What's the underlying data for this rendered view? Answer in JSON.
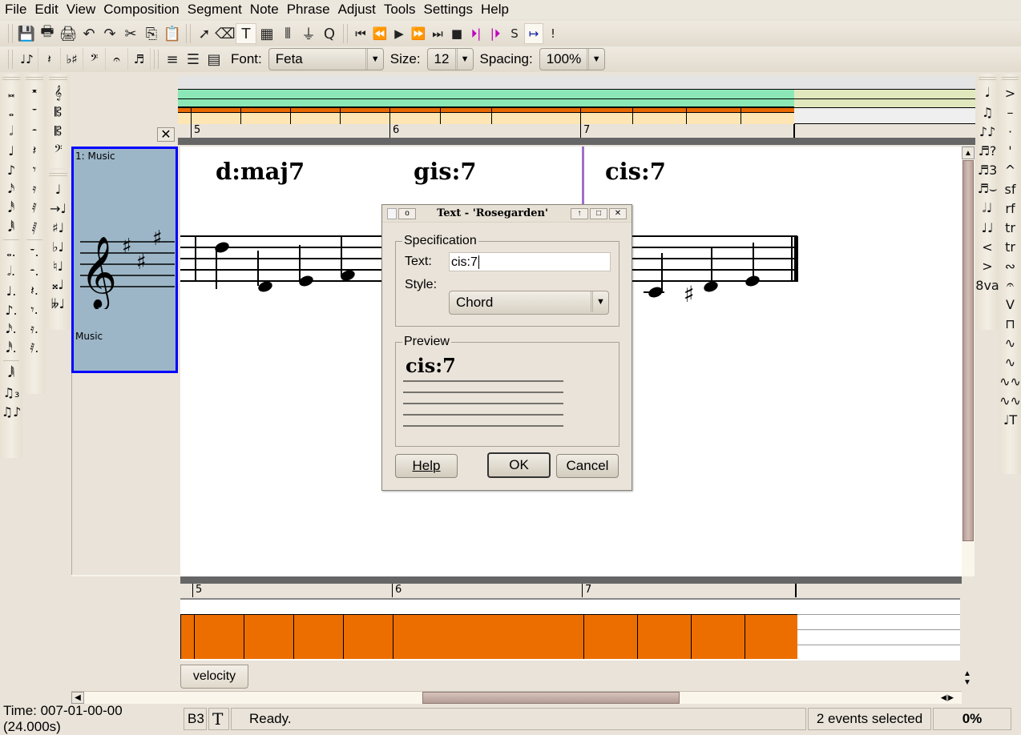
{
  "menu": [
    {
      "label": "File",
      "u": "F"
    },
    {
      "label": "Edit",
      "u": "E"
    },
    {
      "label": "View",
      "u": "V"
    },
    {
      "label": "Composition",
      "u": "C"
    },
    {
      "label": "Segment",
      "u": ""
    },
    {
      "label": "Note",
      "u": "o"
    },
    {
      "label": "Phrase",
      "u": "P"
    },
    {
      "label": "Adjust",
      "u": "A"
    },
    {
      "label": "Tools",
      "u": "T"
    },
    {
      "label": "Settings",
      "u": "S"
    },
    {
      "label": "Help",
      "u": "H"
    }
  ],
  "toolbar1": {
    "file_icons": [
      {
        "name": "save-icon",
        "glyph": "💾"
      },
      {
        "name": "print-icon",
        "glyph": "🖶"
      },
      {
        "name": "print-preview-icon",
        "glyph": "🖨"
      }
    ],
    "edit_icons": [
      {
        "name": "undo-icon",
        "glyph": "↶"
      },
      {
        "name": "redo-icon",
        "glyph": "↷"
      },
      {
        "name": "cut-icon",
        "glyph": "✂"
      },
      {
        "name": "copy-icon",
        "glyph": "⎘"
      },
      {
        "name": "paste-icon",
        "glyph": "📋"
      }
    ],
    "tool_icons": [
      {
        "name": "select-arrow-icon",
        "glyph": "➚"
      },
      {
        "name": "eraser-icon",
        "glyph": "⌫"
      },
      {
        "name": "text-tool-icon",
        "glyph": "T",
        "active": true
      },
      {
        "name": "guitar-chord-icon",
        "glyph": "▦"
      },
      {
        "name": "step-record-icon",
        "glyph": "⫴"
      },
      {
        "name": "filter-icon",
        "glyph": "⏚"
      },
      {
        "name": "quantize-icon",
        "glyph": "Q"
      }
    ],
    "transport_icons": [
      {
        "name": "rewind-to-start-icon",
        "glyph": "⏮"
      },
      {
        "name": "rewind-icon",
        "glyph": "⏪"
      },
      {
        "name": "play-icon",
        "glyph": "▶"
      },
      {
        "name": "fast-forward-icon",
        "glyph": "⏩"
      },
      {
        "name": "fast-forward-to-end-icon",
        "glyph": "⏭"
      },
      {
        "name": "stop-icon",
        "glyph": "■"
      },
      {
        "name": "set-loop-start-icon",
        "glyph": "⏵|"
      },
      {
        "name": "set-loop-end-icon",
        "glyph": "|⏵"
      },
      {
        "name": "solo-icon",
        "glyph": "S"
      },
      {
        "name": "loop-toggle-icon",
        "glyph": "↦"
      },
      {
        "name": "panic-icon",
        "glyph": "!"
      }
    ]
  },
  "toolbar2": {
    "notation_icons": [
      {
        "name": "notes-palette-icon",
        "glyph": "♩♪"
      },
      {
        "name": "rests-palette-icon",
        "glyph": "𝄽"
      },
      {
        "name": "accidentals-palette-icon",
        "glyph": "♭♯"
      },
      {
        "name": "clefs-palette-icon",
        "glyph": "𝄢"
      },
      {
        "name": "marks-palette-icon",
        "glyph": "𝄐"
      },
      {
        "name": "text-palette-icon",
        "glyph": "♬"
      }
    ],
    "layout_icons": [
      {
        "name": "linear-layout-icon",
        "glyph": "≡"
      },
      {
        "name": "continuous-page-icon",
        "glyph": "☰"
      },
      {
        "name": "multi-page-icon",
        "glyph": "▤"
      }
    ],
    "font_label": "Font:",
    "font_value": "Feta",
    "size_label": "Size:",
    "size_value": "12",
    "spacing_label": "Spacing:",
    "spacing_value": "100%"
  },
  "left_palette": {
    "col1": [
      "𝅜",
      "𝅝",
      "𝅗𝅥",
      "♩",
      "♪",
      "𝅘𝅥𝅯",
      "𝅘𝅥𝅰",
      "𝅘𝅥𝅱",
      "𝅝.",
      "𝅗𝅥.",
      "♩.",
      "♪.",
      "𝅘𝅥𝅯.",
      "𝅘𝅥𝅰.",
      "𝅘𝅥𝅲",
      "♫₃",
      "♫♪"
    ],
    "col2": [
      "𝄺",
      "𝄻",
      "𝄼",
      "𝄽",
      "𝄾",
      "𝄿",
      "𝅀",
      "𝅁",
      "𝄻.",
      "𝄼.",
      "𝄽.",
      "𝄾.",
      "𝄿.",
      "𝅀."
    ],
    "clefs": [
      "𝄞",
      "𝄡",
      "𝄡",
      "𝄢"
    ],
    "accidentals": [
      "♩",
      "→♩",
      "♯♩",
      "♭♩",
      "♮♩",
      "𝄪♩",
      "𝄫♩"
    ]
  },
  "right_palette": {
    "col1": [
      "𝅘𝅥",
      "♫",
      "♪♪",
      "♬?",
      "♬3",
      "♬⌣",
      "𝅗𝅥♩",
      "♩♩",
      "<",
      ">",
      "8va"
    ],
    "col2": [
      ">",
      "–",
      "·",
      "'",
      "^",
      "sf",
      "rf",
      "tr",
      "tr",
      "∾",
      "𝄐",
      "V",
      "⊓",
      "∿",
      "∿",
      "∿∿",
      "∿∿",
      "♩T"
    ]
  },
  "track": {
    "number_label": "1: Music",
    "name": "Music",
    "color": "#9cb6c7"
  },
  "ruler": {
    "bars": [
      "5",
      "6",
      "7"
    ]
  },
  "chords": [
    "d:maj7",
    "gis:7",
    "cis:7"
  ],
  "dialog": {
    "title": "Text - 'Rosegarden'",
    "spec_legend": "Specification",
    "text_label": "Text:",
    "text_value": "cis:7",
    "style_label": "Style:",
    "style_value": "Chord",
    "preview_legend": "Preview",
    "preview_text": "cis:7",
    "help_label": "Help",
    "ok_label": "OK",
    "cancel_label": "Cancel"
  },
  "velocity": {
    "tab_label": "velocity",
    "bars": [
      "5",
      "6",
      "7"
    ]
  },
  "status": {
    "time": "Time: 007-01-00-00 (24.000s)",
    "pitch": "B3",
    "tool": "T",
    "message": "Ready.",
    "selection": "2 events selected",
    "progress": "0%"
  }
}
